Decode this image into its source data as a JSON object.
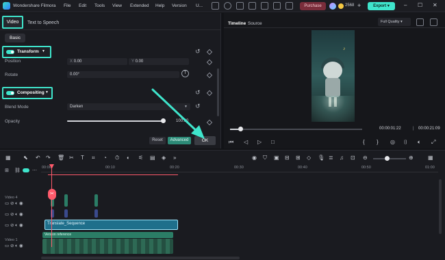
{
  "app": {
    "title": "Wondershare Filmora",
    "menu": [
      "File",
      "Edit",
      "Tools",
      "View",
      "Extended",
      "Help",
      "Version",
      "U..."
    ],
    "purchase_label": "Purchase",
    "credits": "2568",
    "export_label": "Export"
  },
  "colors": {
    "accent": "#3fe5cc",
    "purchase": "#7a2d3b",
    "export": "#3fe5cc",
    "clip_blue": "#1f6f8b",
    "clip_green": "#2b7d66",
    "playhead": "#ff5a6b"
  },
  "properties": {
    "tabs": [
      "Video",
      "Text to Speech"
    ],
    "subtab": "Basic",
    "transform": {
      "title": "Transform",
      "position_label": "Position",
      "x_prefix": "X",
      "x_value": "0.00",
      "y_prefix": "Y",
      "y_value": "0.00",
      "rotate_label": "Rotate",
      "rotate_value": "0.00°"
    },
    "compositing": {
      "title": "Compositing",
      "blend_label": "Blend Mode",
      "blend_value": "Darken",
      "opacity_label": "Opacity",
      "opacity_value": "100.00",
      "opacity_fraction": 1.0
    },
    "buttons": {
      "reset": "Reset",
      "advanced": "Advanced",
      "ok": "OK"
    }
  },
  "preview": {
    "tabs": [
      "Timeline",
      "Source"
    ],
    "quality": "Full Quality",
    "current_time": "00:00:01:22",
    "total_time": "00:00:21:09",
    "progress_fraction": 0.08
  },
  "timeline": {
    "ruler": [
      "00:00",
      "00:10",
      "00:20",
      "00:30",
      "00:40",
      "00:50",
      "01:00"
    ],
    "tracks": [
      {
        "label": "Video 4"
      },
      {
        "label": ""
      },
      {
        "label": ""
      },
      {
        "label": "Video 1"
      }
    ],
    "clips": {
      "sequence": "Translate_Sequence",
      "reference": "Version reference"
    },
    "icons": [
      "select-icon",
      "undo-icon",
      "redo-icon",
      "delete-icon",
      "cut-icon",
      "text-icon",
      "crop-icon",
      "speed-icon",
      "timer-icon",
      "color-icon",
      "audio-icon",
      "mic-icon",
      "zoom-out-icon",
      "zoom-in-icon",
      "grid-icon"
    ]
  }
}
